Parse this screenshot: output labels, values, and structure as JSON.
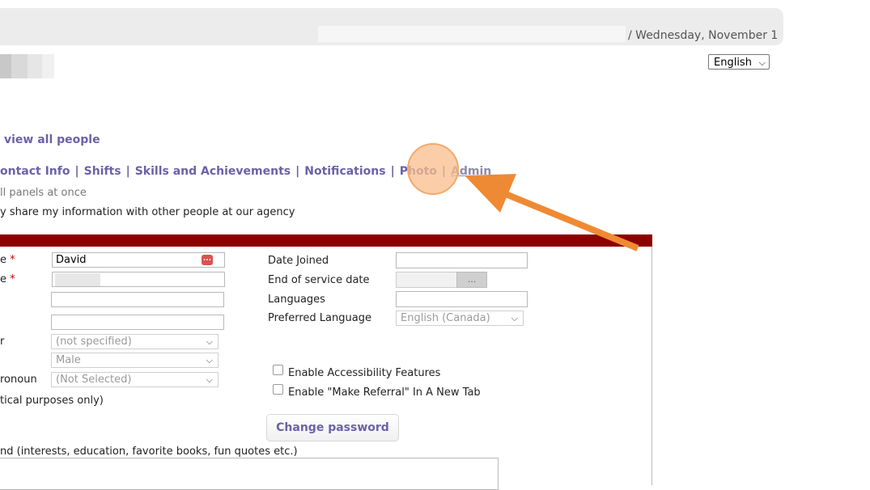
{
  "header": {
    "date": "/ Wednesday, November 1",
    "language_select": "English"
  },
  "nav": {
    "view_all_link": "view all people",
    "tabs": [
      "ontact Info",
      "Shifts",
      "Skills and Achievements",
      "Notifications",
      "Photo",
      "Admin"
    ],
    "separator": "|",
    "panels_note": "ll panels at once",
    "share_note": "y share my information with other people at our agency"
  },
  "form": {
    "left_labels": {
      "first_name": "e",
      "last_name": "e",
      "gender_label": "r",
      "pronoun_label": "ronoun",
      "stats_note": "tical purposes only)"
    },
    "required_mark": "*",
    "first_name_value": "David",
    "kebab_icon": "...",
    "gender_select": "(not specified)",
    "sex_select": "Male",
    "pronoun_select": "(Not Selected)",
    "right_labels": {
      "date_joined": "Date Joined",
      "end_of_service": "End of service date",
      "languages": "Languages",
      "preferred_language": "Preferred Language"
    },
    "preferred_language_value": "English (Canada)",
    "date_picker_button": "...",
    "checkbox_accessibility": "Enable Accessibility Features",
    "checkbox_referral": "Enable \"Make Referral\" In A New Tab",
    "change_password": "Change password",
    "bio_label": "nd (interests, education, favorite books, fun quotes etc.)"
  },
  "colors": {
    "link": "#6a62a8",
    "header_bar": "#8b0000",
    "highlight": "#f3a96b",
    "arrow": "#ef8a34"
  }
}
